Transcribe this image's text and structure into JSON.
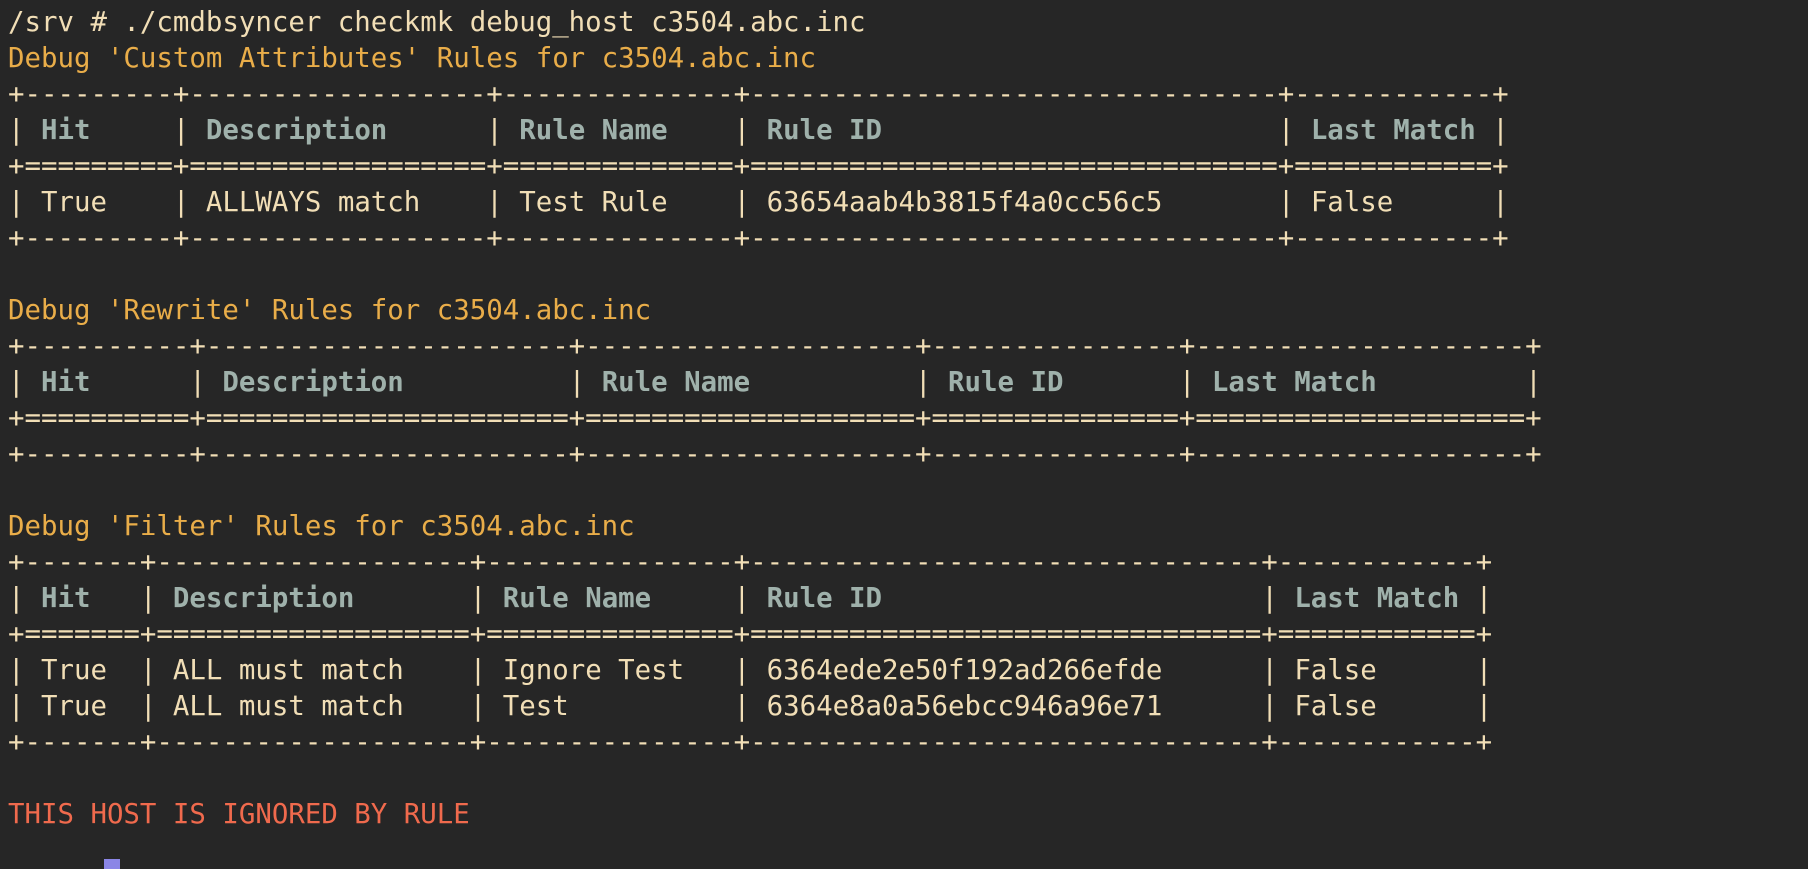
{
  "terminal": {
    "command_line": "/srv # ./cmdbsyncer checkmk debug_host c3504.abc.inc",
    "footer_message": "THIS HOST IS IGNORED BY RULE"
  },
  "colors": {
    "background": "#262626",
    "text": "#f1deb6",
    "heading": "#e9ad49",
    "header_cells": "#9fb1ab",
    "warning": "#f06a4d",
    "cursor": "#8b86e6"
  },
  "sections": [
    {
      "heading": "Debug 'Custom Attributes' Rules for c3504.abc.inc",
      "border": "+---------+------------------+--------------+--------------------------------+------------+",
      "separator": "+=========+==================+==============+================================+============+",
      "columns": [
        {
          "text": "Hit",
          "w": 9
        },
        {
          "text": "Description",
          "w": 18
        },
        {
          "text": "Rule Name",
          "w": 14
        },
        {
          "text": "Rule ID",
          "w": 32
        },
        {
          "text": "Last Match",
          "w": 12
        }
      ],
      "rows": [
        [
          "True",
          "ALLWAYS match",
          "Test Rule",
          "63654aab4b3815f4a0cc56c5",
          "False"
        ]
      ]
    },
    {
      "heading": "Debug 'Rewrite' Rules for c3504.abc.inc",
      "border": "+----------+----------------------+--------------------+---------------+--------------------+",
      "separator": "+==========+======================+====================+===============+====================+",
      "columns": [
        {
          "text": "Hit",
          "w": 10
        },
        {
          "text": "Description",
          "w": 22
        },
        {
          "text": "Rule Name",
          "w": 20
        },
        {
          "text": "Rule ID",
          "w": 15
        },
        {
          "text": "Last Match",
          "w": 20
        }
      ],
      "rows": []
    },
    {
      "heading": "Debug 'Filter' Rules for c3504.abc.inc",
      "border": "+-------+-------------------+---------------+-------------------------------+------------+",
      "separator": "+=======+===================+===============+===============================+============+",
      "columns": [
        {
          "text": "Hit",
          "w": 7
        },
        {
          "text": "Description",
          "w": 19
        },
        {
          "text": "Rule Name",
          "w": 15
        },
        {
          "text": "Rule ID",
          "w": 31
        },
        {
          "text": "Last Match",
          "w": 12
        }
      ],
      "rows": [
        [
          "True",
          "ALL must match",
          "Ignore Test",
          "6364ede2e50f192ad266efde",
          "False"
        ],
        [
          "True",
          "ALL must match",
          "Test",
          "6364e8a0a56ebcc946a96e71",
          "False"
        ]
      ]
    }
  ]
}
